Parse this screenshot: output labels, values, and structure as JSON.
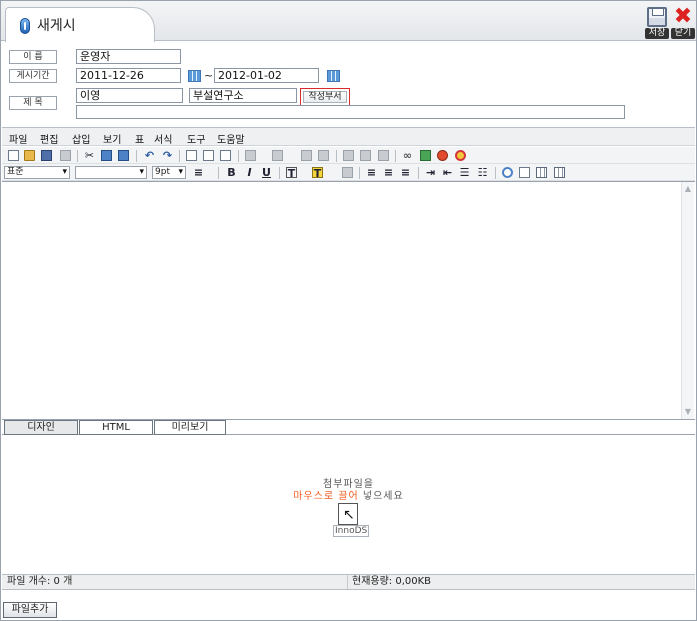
{
  "header": {
    "title": "새게시",
    "save_label": "저장",
    "close_label": "닫기"
  },
  "form": {
    "name_label": "이  름",
    "name_value": "운영자",
    "period_label": "게시기간",
    "period_start": "2011-12-26",
    "period_sep": "~",
    "period_end": "2012-01-02",
    "title_label": "제  목",
    "writer_value": "이영",
    "dept_value": "부설연구소",
    "dept_button": "작성부서",
    "subject_value": ""
  },
  "editor": {
    "menu": [
      "파일",
      "편집",
      "삽입",
      "보기",
      "표",
      "서식",
      "도구",
      "도움말"
    ],
    "style_select": "표준",
    "font_select": "",
    "size_select": "9pt",
    "tabs": [
      "디자인",
      "HTML",
      "미리보기"
    ],
    "active_tab": "디자인"
  },
  "upload": {
    "line1": "첨부파일을",
    "line2_orange": "마우스로 끌어",
    "line2_gray": "넣으세요",
    "brand": "InnoDS",
    "file_count": "파일 개수: 0 개",
    "capacity": "현재용량: 0,00KB",
    "add_button": "파일추가"
  },
  "colors": {
    "accent_orange": "#f05a1c",
    "dept_button_border": "#d92b2b",
    "close_red": "#dd2222"
  }
}
